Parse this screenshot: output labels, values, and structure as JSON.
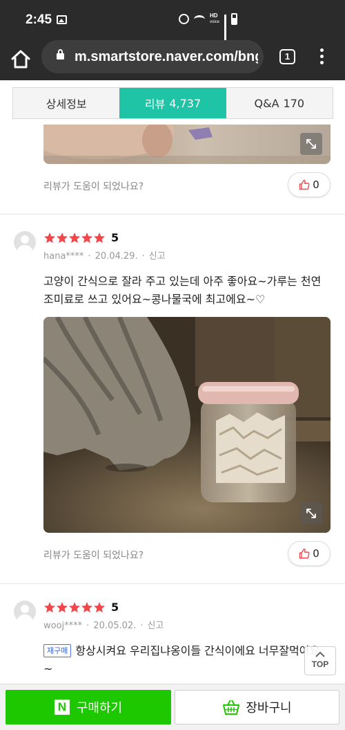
{
  "status_bar": {
    "time": "2:45",
    "hd_label": "HD",
    "voice_label": "voice"
  },
  "browser": {
    "url": "m.smartstore.naver.com/bngf",
    "tab_count": "1"
  },
  "product_tabs": [
    {
      "label": "상세정보",
      "count": ""
    },
    {
      "label": "리뷰",
      "count": "4,737"
    },
    {
      "label": "Q&A",
      "count": "170"
    }
  ],
  "helpful_question": "리뷰가 도움이 되었나요?",
  "reviews": [
    {
      "helpful_count": "0"
    },
    {
      "rating": 5,
      "score": "5",
      "user": "hana****",
      "date": "20.04.29.",
      "report": "신고",
      "text": "고양이 간식으로 잘라 주고 있는데 아주 좋아요~가루는 천연 조미료로 쓰고 있어요~콩나물국에 최고에요~♡",
      "helpful_count": "0"
    },
    {
      "rating": 5,
      "score": "5",
      "user": "wooj****",
      "date": "20.05.02.",
      "report": "신고",
      "badge": "재구매",
      "text": "항상시켜요 우리집냐옹이들 간식이에요 너무잘먹어요~"
    }
  ],
  "top_button": "TOP",
  "bottom_bar": {
    "buy_label": "구매하기",
    "buy_logo": "N",
    "cart_label": "장바구니"
  },
  "colors": {
    "accent": "#1fc3a6",
    "naver_green": "#1ec800",
    "star": "#f0474b"
  }
}
